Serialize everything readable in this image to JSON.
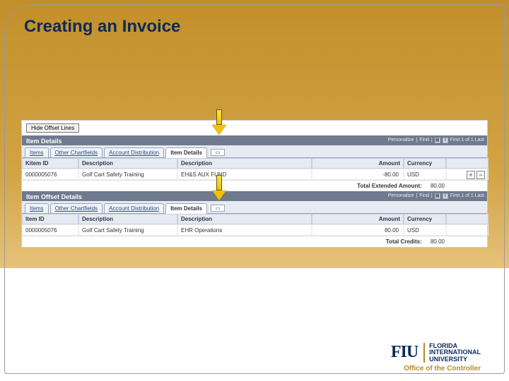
{
  "slide": {
    "title": "Creating an Invoice"
  },
  "panel": {
    "hide_button": "Hide Offset Lines"
  },
  "section1": {
    "title": "Item Details",
    "controls": {
      "personalize": "Personalize",
      "find": "Find",
      "nav": "First 1 of 1 Last"
    },
    "tabs": {
      "t0": "Items",
      "t1": "Other Chartfields",
      "t2": "Account Distribution",
      "t3": "Item Details"
    },
    "cols": {
      "c0": "Kitem ID",
      "c1": "Description",
      "c2": "Description",
      "c3": "Amount",
      "c4": "Currency"
    },
    "row": {
      "id": "0000005076",
      "desc1": "Golf Cart Safety Training",
      "desc2": "EH&S AUX FUND",
      "amount": "-80.00",
      "currency": "USD"
    },
    "total_label": "Total Extended Amount:",
    "total_value": "80.00"
  },
  "section2": {
    "title": "Item Offset Details",
    "controls": {
      "personalize": "Personalize",
      "find": "Find",
      "nav": "First 1 of 1 Last"
    },
    "tabs": {
      "t0": "Items",
      "t1": "Other Chartfields",
      "t2": "Account Distribution",
      "t3": "Item Details"
    },
    "cols": {
      "c0": "Item ID",
      "c1": "Description",
      "c2": "Description",
      "c3": "Amount",
      "c4": "Currency"
    },
    "row": {
      "id": "0000005076",
      "desc1": "Golf Cart Safety Training",
      "desc2": "EHR Operations",
      "amount": "80.00",
      "currency": "USD"
    },
    "total_label": "Total Credits:",
    "total_value": "80.00"
  },
  "footer": {
    "logo_mark": "FIU",
    "logo_line1": "FLORIDA",
    "logo_line2": "INTERNATIONAL",
    "logo_line3": "UNIVERSITY",
    "subtitle": "Office of the Controller"
  }
}
